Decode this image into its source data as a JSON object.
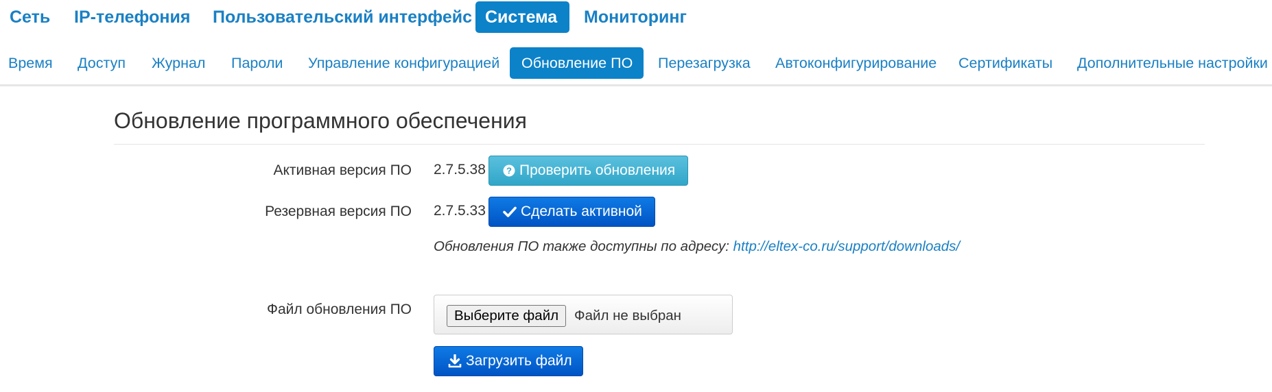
{
  "top_nav": {
    "items": [
      {
        "label": "Сеть"
      },
      {
        "label": "IP-телефония"
      },
      {
        "label": "Пользовательский интерфейс"
      },
      {
        "label": "Система",
        "active": true
      },
      {
        "label": "Мониторинг"
      }
    ]
  },
  "sub_nav": {
    "items": [
      {
        "label": "Время"
      },
      {
        "label": "Доступ"
      },
      {
        "label": "Журнал"
      },
      {
        "label": "Пароли"
      },
      {
        "label": "Управление конфигурацией"
      },
      {
        "label": "Обновление ПО",
        "active": true
      },
      {
        "label": "Перезагрузка"
      },
      {
        "label": "Автоконфигурирование"
      },
      {
        "label": "Сертификаты"
      },
      {
        "label": "Дополнительные настройки"
      }
    ]
  },
  "page": {
    "title": "Обновление программного обеспечения"
  },
  "firmware": {
    "active_label": "Активная версия ПО",
    "active_version": "2.7.5.38",
    "check_updates_label": "Проверить обновления",
    "backup_label": "Резервная версия ПО",
    "backup_version": "2.7.5.33",
    "make_active_label": "Сделать активной",
    "note_text": "Обновления ПО также доступны по адресу:",
    "note_link": "http://eltex-co.ru/support/downloads/",
    "file_label": "Файл обновления ПО",
    "choose_file_label": "Выберите файл",
    "file_status": "Файл не выбран",
    "upload_label": "Загрузить файл"
  },
  "icons": {
    "check_updates": "question-circle-icon",
    "make_active": "checkmark-icon",
    "upload": "download-icon"
  },
  "colors": {
    "link": "#1a80c4",
    "nav_active_bg": "#0c82c9",
    "btn_info": "#5bc0de",
    "btn_primary": "#0a64d8"
  }
}
